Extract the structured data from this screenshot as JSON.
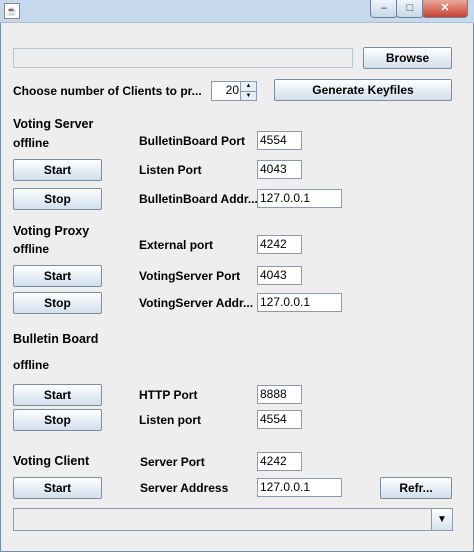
{
  "window": {
    "icon": "java-icon",
    "controls": {
      "minimize": "–",
      "maximize": "□",
      "close": "✕"
    }
  },
  "top": {
    "path_value": "",
    "browse_label": "Browse",
    "clients_label": "Choose number of Clients to pr...",
    "clients_count": "20",
    "generate_label": "Generate Keyfiles"
  },
  "voting_server": {
    "title": "Voting Server",
    "status": "offline",
    "start_label": "Start",
    "stop_label": "Stop",
    "bb_port_label": "BulletinBoard Port",
    "bb_port_value": "4554",
    "listen_port_label": "Listen Port",
    "listen_port_value": "4043",
    "bb_addr_label": "BulletinBoard Addr...",
    "bb_addr_value": "127.0.0.1"
  },
  "voting_proxy": {
    "title": "Voting Proxy",
    "status": "offline",
    "start_label": "Start",
    "stop_label": "Stop",
    "external_port_label": "External port",
    "external_port_value": "4242",
    "vs_port_label": "VotingServer Port",
    "vs_port_value": "4043",
    "vs_addr_label": "VotingServer Addr...",
    "vs_addr_value": "127.0.0.1"
  },
  "bulletin_board": {
    "title": "Bulletin Board",
    "status": "offline",
    "start_label": "Start",
    "stop_label": "Stop",
    "http_port_label": "HTTP Port",
    "http_port_value": "8888",
    "listen_port_label": "Listen port",
    "listen_port_value": "4554"
  },
  "voting_client": {
    "title": "Voting Client",
    "start_label": "Start",
    "server_port_label": "Server Port",
    "server_port_value": "4242",
    "server_addr_label": "Server Address",
    "server_addr_value": "127.0.0.1",
    "refresh_label": "Refr...",
    "combo_value": ""
  }
}
